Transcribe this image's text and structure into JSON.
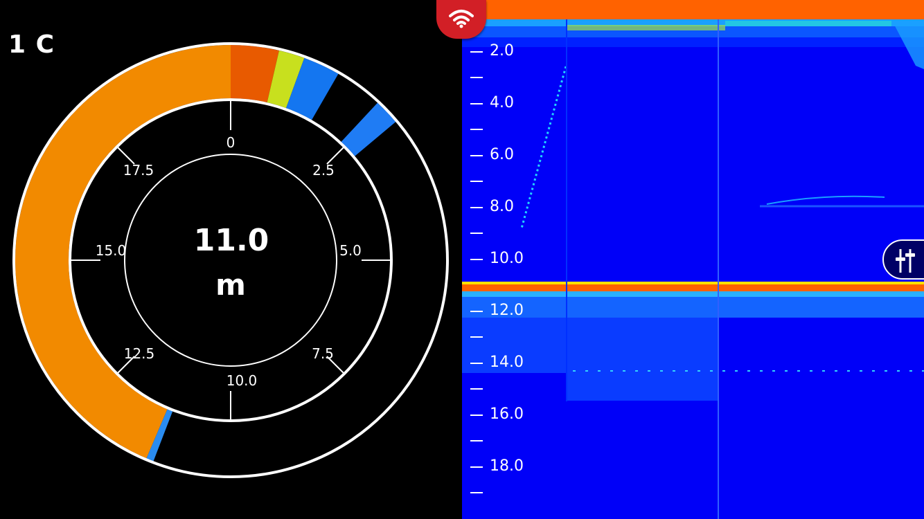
{
  "channel": {
    "label": "1 C"
  },
  "dial": {
    "depth_value": "11.0",
    "depth_unit": "m",
    "scale_labels": [
      "0",
      "2.5",
      "5.0",
      "7.5",
      "10.0",
      "12.5",
      "15.0",
      "17.5"
    ]
  },
  "sonar": {
    "depth_ticks": [
      "2.0",
      "4.0",
      "6.0",
      "8.0",
      "10.0",
      "12.0",
      "14.0",
      "16.0",
      "18.0"
    ]
  },
  "icons": {
    "wifi": "wifi-icon",
    "settings": "sliders-icon"
  },
  "colors": {
    "sonar_background": "#0000f8",
    "strong_return": "#ff6a00",
    "dial_fill": "#f28a00",
    "wifi_tab": "#d21f26"
  }
}
